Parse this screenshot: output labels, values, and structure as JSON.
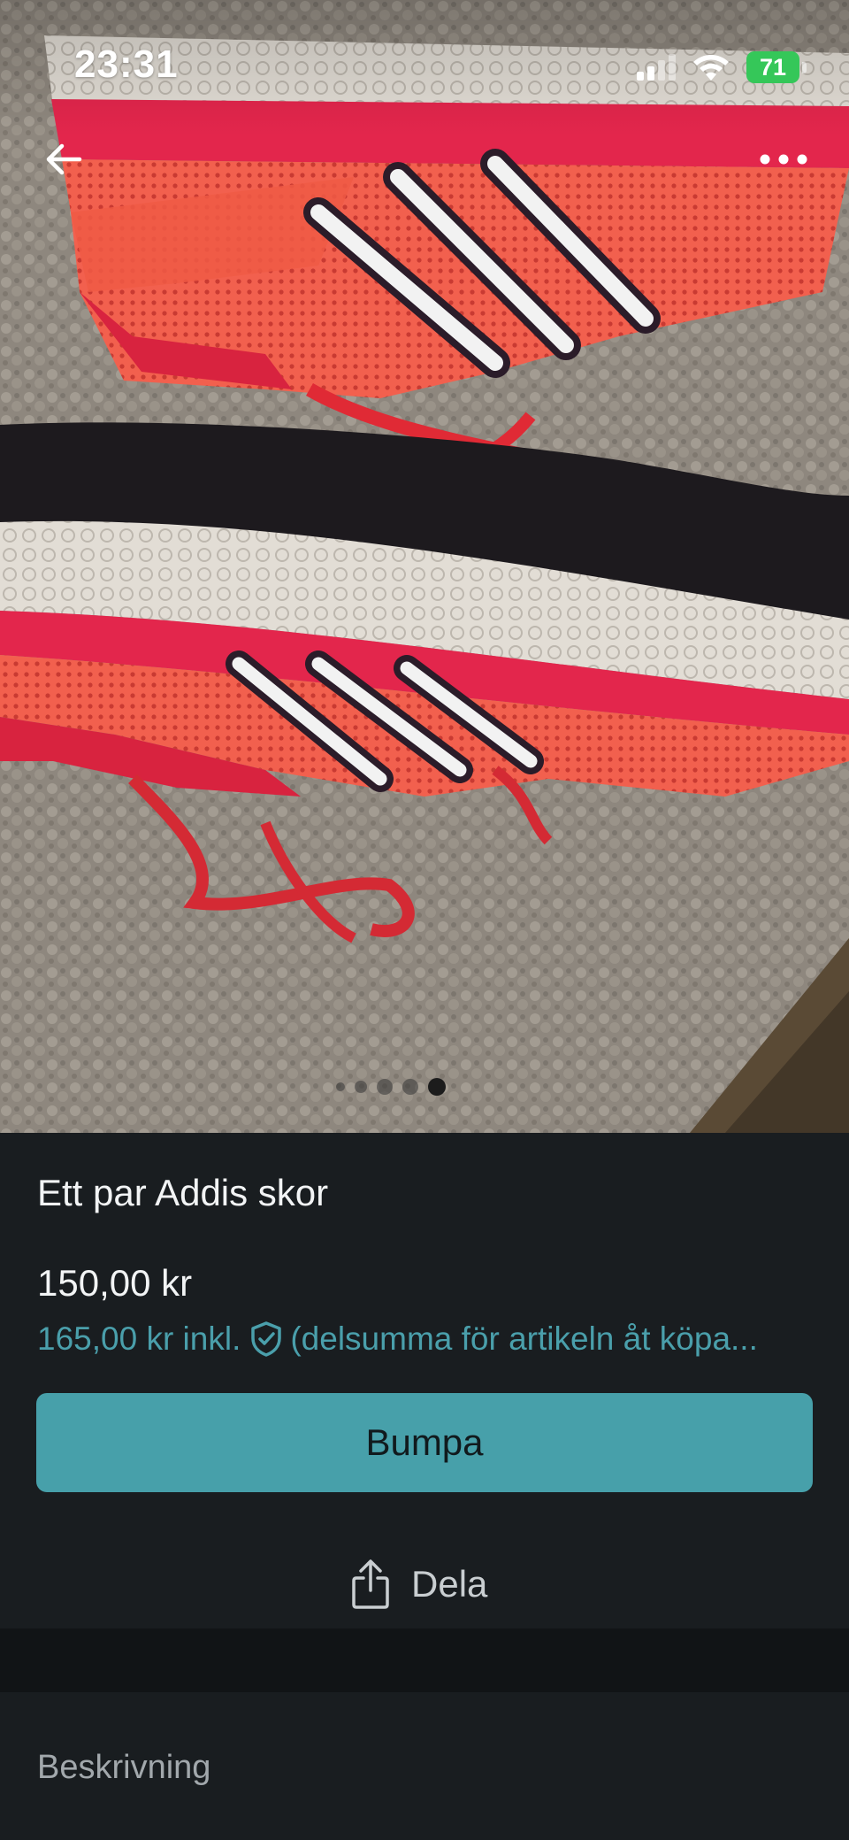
{
  "status_bar": {
    "time": "23:31",
    "battery_percent": "71",
    "signal_icon": "cellular-signal-icon",
    "wifi_icon": "wifi-icon",
    "battery_charging": true
  },
  "nav": {
    "back_icon": "arrow-left-icon",
    "more_icon": "more-horizontal-icon"
  },
  "gallery": {
    "image_count": 5,
    "active_index": 4,
    "photo_description_icon": "product-photo"
  },
  "listing": {
    "title": "Ett par Addis skor",
    "price": "150,00 kr",
    "price_incl": "165,00 kr inkl.",
    "price_incl_note": "(delsumma för artikeln åt köpa...",
    "protection_icon": "shield-check-icon"
  },
  "actions": {
    "bump_label": "Bumpa",
    "share_label": "Dela",
    "share_icon": "share-icon"
  },
  "description": {
    "heading": "Beskrivning"
  },
  "colors": {
    "accent": "#47a0aa",
    "link": "#4a9fab",
    "background": "#191d20",
    "separator": "#111416",
    "battery": "#35c759"
  }
}
